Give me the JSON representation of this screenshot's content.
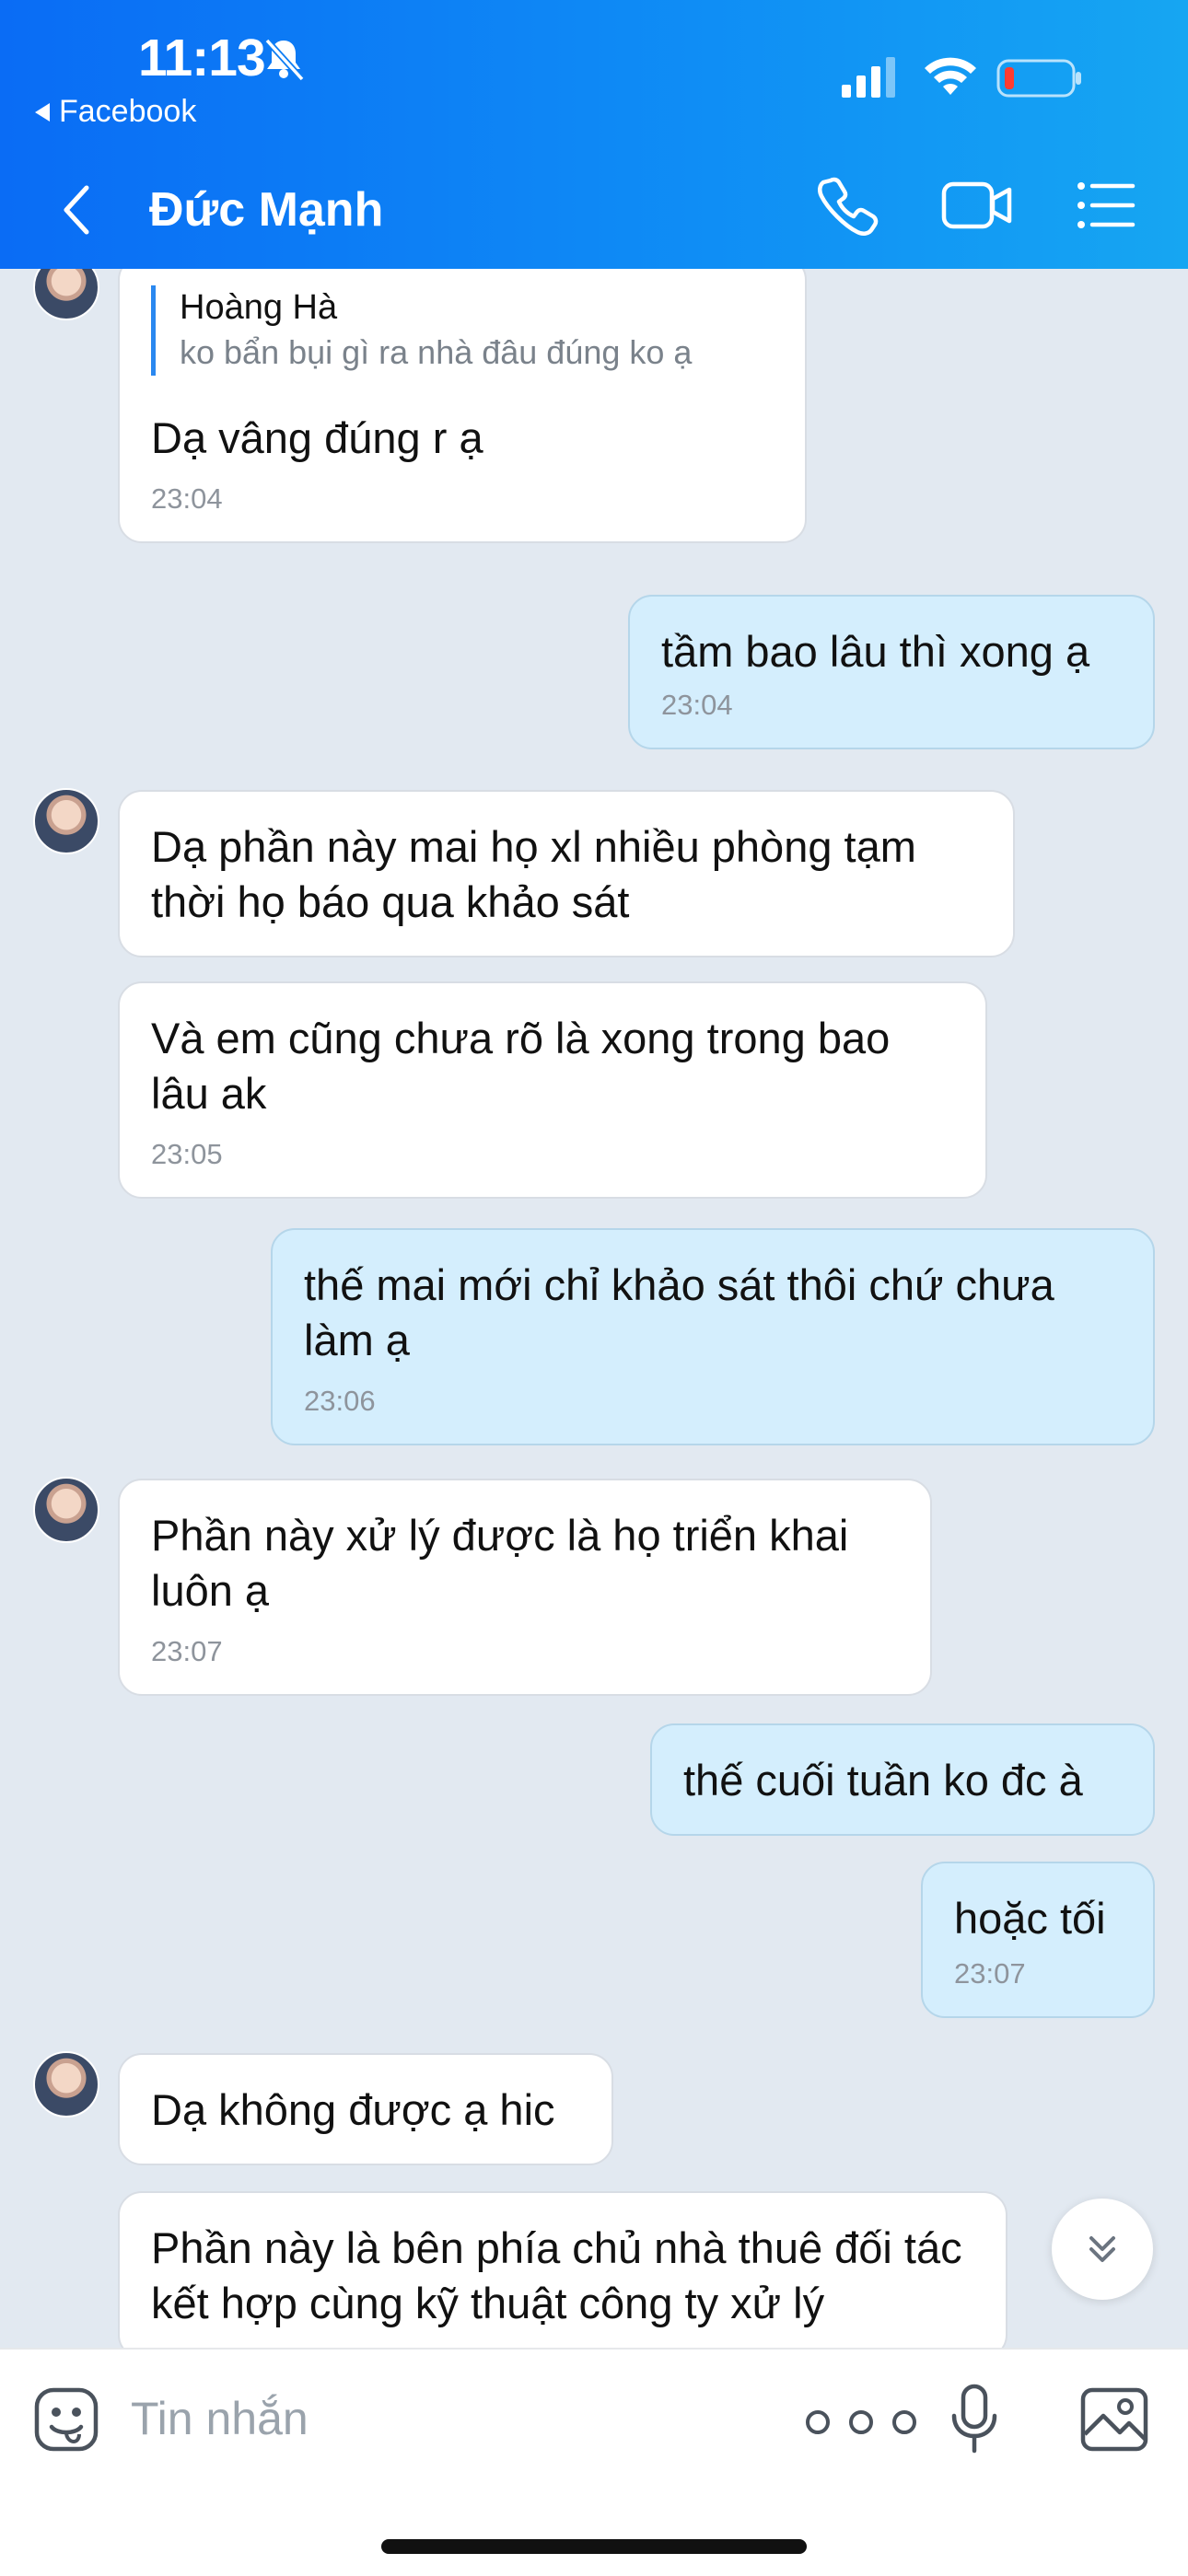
{
  "status_bar": {
    "time": "11:13",
    "back_app": "Facebook"
  },
  "header": {
    "contact_name": "Đức Mạnh"
  },
  "messages": [
    {
      "dir": "in",
      "quote_name": "Hoàng Hà",
      "quote_text": "ko bẩn bụi gì ra nhà đâu đúng ko ạ",
      "text": "Dạ vâng đúng r ạ",
      "time": "23:04"
    },
    {
      "dir": "out",
      "text": "tầm bao lâu thì xong ạ",
      "time": "23:04"
    },
    {
      "dir": "in",
      "text": "Dạ phần này mai họ xl nhiều phòng tạm thời họ báo qua khảo sát"
    },
    {
      "dir": "in",
      "text": "Và em cũng chưa rõ là xong trong bao lâu ak",
      "time": "23:05"
    },
    {
      "dir": "out",
      "text": "thế mai mới chỉ khảo sát thôi chứ chưa làm ạ",
      "time": "23:06"
    },
    {
      "dir": "in",
      "text": "Phần này xử lý được là họ triển khai luôn ạ",
      "time": "23:07"
    },
    {
      "dir": "out",
      "text": "thế cuối tuần ko đc à"
    },
    {
      "dir": "out",
      "text": "hoặc tối",
      "time": "23:07"
    },
    {
      "dir": "in",
      "text": "Dạ không được ạ hic"
    },
    {
      "dir": "in",
      "text": "Phần này là bên phía chủ nhà thuê đối tác kết hợp cùng kỹ thuật công ty xử lý"
    }
  ],
  "input": {
    "placeholder": "Tin nhắn"
  },
  "colors": {
    "header_start": "#0a6cf5",
    "header_end": "#16a6f2",
    "outgoing_bubble": "#d4eefd",
    "incoming_bubble": "#ffffff",
    "chat_bg": "#e2e9f1"
  }
}
